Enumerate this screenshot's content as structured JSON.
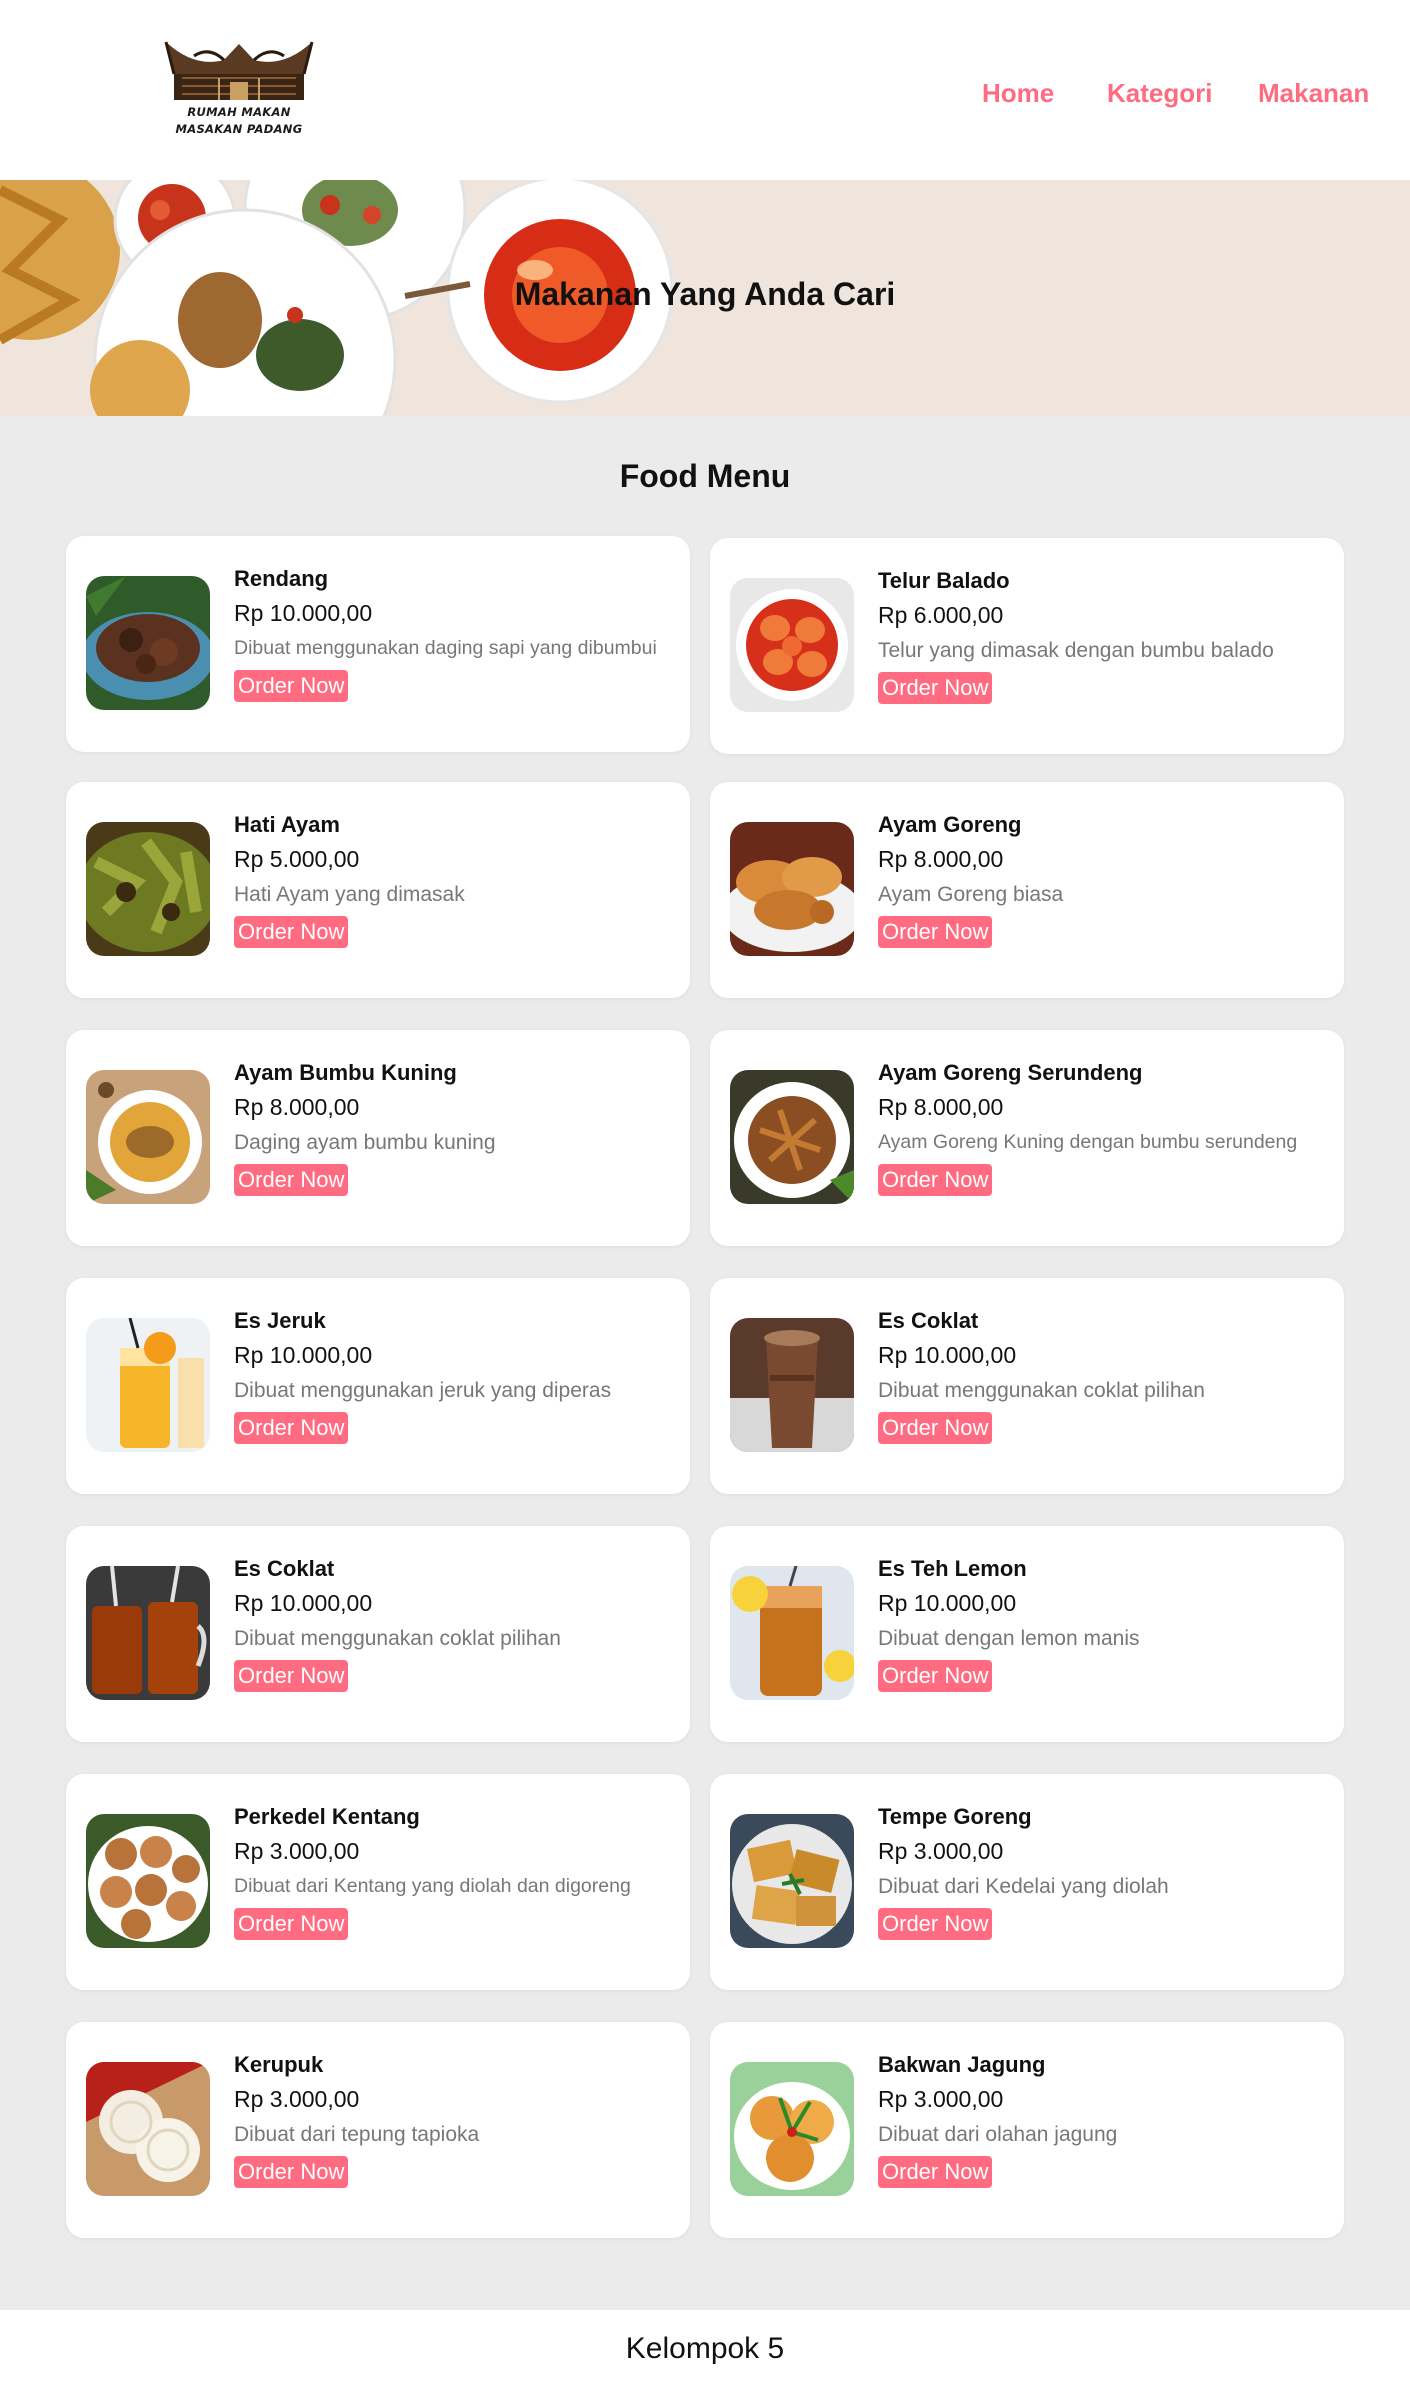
{
  "nav": {
    "logo_line1": "RUMAH MAKAN",
    "logo_line2": "MASAKAN PADANG",
    "links": [
      "Home",
      "Kategori",
      "Makanan"
    ]
  },
  "hero": {
    "title": "Makanan Yang Anda Cari"
  },
  "menu": {
    "title": "Food Menu",
    "order_label": "Order Now",
    "items": [
      {
        "name": "Rendang",
        "price": "Rp 10.000,00",
        "desc": "Dibuat menggunakan daging sapi yang dibumbui",
        "image": "rendang-photo"
      },
      {
        "name": "Telur Balado",
        "price": "Rp 6.000,00",
        "desc": "Telur yang dimasak dengan bumbu balado",
        "image": "telur-balado-photo"
      },
      {
        "name": "Hati Ayam",
        "price": "Rp 5.000,00",
        "desc": "Hati Ayam yang dimasak",
        "image": "hati-ayam-photo"
      },
      {
        "name": "Ayam Goreng",
        "price": "Rp 8.000,00",
        "desc": "Ayam Goreng biasa",
        "image": "ayam-goreng-photo"
      },
      {
        "name": "Ayam Bumbu Kuning",
        "price": "Rp 8.000,00",
        "desc": "Daging ayam bumbu kuning",
        "image": "ayam-bumbu-kuning-photo"
      },
      {
        "name": "Ayam Goreng Serundeng",
        "price": "Rp 8.000,00",
        "desc": "Ayam Goreng Kuning dengan bumbu serundeng",
        "image": "ayam-serundeng-photo"
      },
      {
        "name": "Es Jeruk",
        "price": "Rp 10.000,00",
        "desc": "Dibuat menggunakan jeruk yang diperas",
        "image": "es-jeruk-photo"
      },
      {
        "name": "Es Coklat",
        "price": "Rp 10.000,00",
        "desc": "Dibuat menggunakan coklat pilihan",
        "image": "es-coklat-photo"
      },
      {
        "name": "Es Coklat",
        "price": "Rp 10.000,00",
        "desc": "Dibuat menggunakan coklat pilihan",
        "image": "es-teh-jar-photo"
      },
      {
        "name": "Es Teh Lemon",
        "price": "Rp 10.000,00",
        "desc": "Dibuat dengan lemon manis",
        "image": "es-teh-lemon-photo"
      },
      {
        "name": "Perkedel Kentang",
        "price": "Rp 3.000,00",
        "desc": "Dibuat dari Kentang yang diolah dan digoreng",
        "image": "perkedel-photo"
      },
      {
        "name": "Tempe Goreng",
        "price": "Rp 3.000,00",
        "desc": "Dibuat dari Kedelai yang diolah",
        "image": "tempe-goreng-photo"
      },
      {
        "name": "Kerupuk",
        "price": "Rp 3.000,00",
        "desc": "Dibuat dari tepung tapioka",
        "image": "kerupuk-photo"
      },
      {
        "name": "Bakwan Jagung",
        "price": "Rp 3.000,00",
        "desc": "Dibuat dari olahan jagung",
        "image": "bakwan-jagung-photo"
      }
    ]
  },
  "footer": {
    "text": "Kelompok 5"
  },
  "colors": {
    "accent": "#ff6b81",
    "page_bg": "#ebebeb",
    "hero_bg": "#f0e5dc",
    "card_bg": "#ffffff"
  }
}
